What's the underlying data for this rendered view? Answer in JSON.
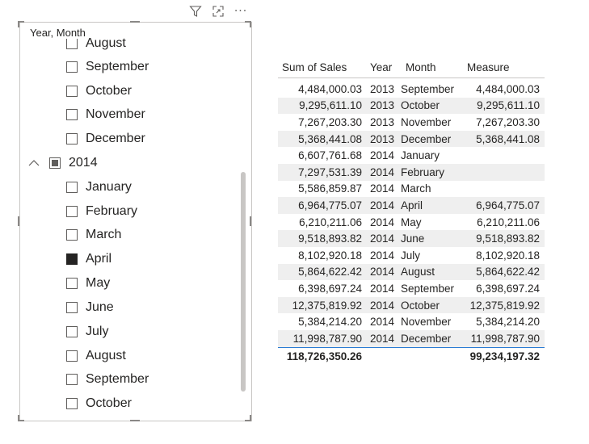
{
  "toolbar": {
    "icons": [
      "filter-icon",
      "focus-mode-icon",
      "more-options-icon"
    ],
    "more_label": "···"
  },
  "slicer": {
    "title": "Year, Month",
    "items": [
      {
        "type": "month",
        "label": "August",
        "checked": false
      },
      {
        "type": "month",
        "label": "September",
        "checked": false
      },
      {
        "type": "month",
        "label": "October",
        "checked": false
      },
      {
        "type": "month",
        "label": "November",
        "checked": false
      },
      {
        "type": "month",
        "label": "December",
        "checked": false
      },
      {
        "type": "year",
        "label": "2014",
        "state": "partial",
        "expanded": true
      },
      {
        "type": "month",
        "label": "January",
        "checked": false
      },
      {
        "type": "month",
        "label": "February",
        "checked": false
      },
      {
        "type": "month",
        "label": "March",
        "checked": false
      },
      {
        "type": "month",
        "label": "April",
        "checked": true
      },
      {
        "type": "month",
        "label": "May",
        "checked": false
      },
      {
        "type": "month",
        "label": "June",
        "checked": false
      },
      {
        "type": "month",
        "label": "July",
        "checked": false
      },
      {
        "type": "month",
        "label": "August",
        "checked": false
      },
      {
        "type": "month",
        "label": "September",
        "checked": false
      },
      {
        "type": "month",
        "label": "October",
        "checked": false
      }
    ]
  },
  "table": {
    "headers": [
      "Sum of Sales",
      "Year",
      "Month",
      "Measure"
    ],
    "rows": [
      [
        "4,484,000.03",
        "2013",
        "September",
        "4,484,000.03"
      ],
      [
        "9,295,611.10",
        "2013",
        "October",
        "9,295,611.10"
      ],
      [
        "7,267,203.30",
        "2013",
        "November",
        "7,267,203.30"
      ],
      [
        "5,368,441.08",
        "2013",
        "December",
        "5,368,441.08"
      ],
      [
        "6,607,761.68",
        "2014",
        "January",
        ""
      ],
      [
        "7,297,531.39",
        "2014",
        "February",
        ""
      ],
      [
        "5,586,859.87",
        "2014",
        "March",
        ""
      ],
      [
        "6,964,775.07",
        "2014",
        "April",
        "6,964,775.07"
      ],
      [
        "6,210,211.06",
        "2014",
        "May",
        "6,210,211.06"
      ],
      [
        "9,518,893.82",
        "2014",
        "June",
        "9,518,893.82"
      ],
      [
        "8,102,920.18",
        "2014",
        "July",
        "8,102,920.18"
      ],
      [
        "5,864,622.42",
        "2014",
        "August",
        "5,864,622.42"
      ],
      [
        "6,398,697.24",
        "2014",
        "September",
        "6,398,697.24"
      ],
      [
        "12,375,819.92",
        "2014",
        "October",
        "12,375,819.92"
      ],
      [
        "5,384,214.20",
        "2014",
        "November",
        "5,384,214.20"
      ],
      [
        "11,998,787.90",
        "2014",
        "December",
        "11,998,787.90"
      ]
    ],
    "totals": [
      "118,726,350.26",
      "",
      "",
      "99,234,197.32"
    ]
  },
  "colors": {
    "checked": "#252423",
    "alt_row": "#efefef",
    "total_line": "#2b7cd3",
    "border": "#c8c6c4"
  }
}
